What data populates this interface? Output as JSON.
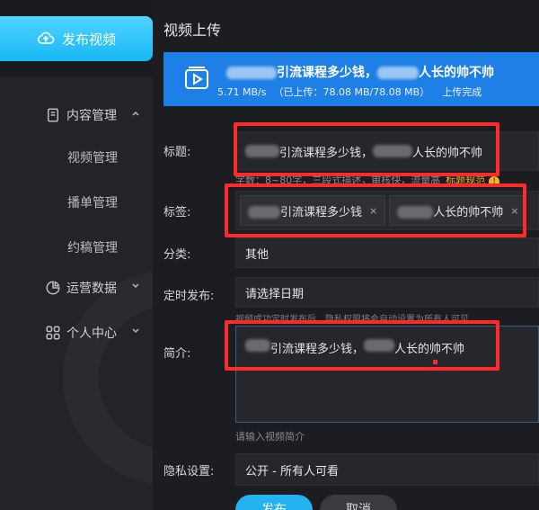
{
  "sidebar": {
    "publish_button": "发布视频",
    "items": [
      {
        "label": "内容管理",
        "icon": "file-icon",
        "expanded": true
      },
      {
        "label": "视频管理"
      },
      {
        "label": "播单管理"
      },
      {
        "label": "约稿管理"
      },
      {
        "label": "运营数据",
        "icon": "pie-chart-icon",
        "expanded": false
      },
      {
        "label": "个人中心",
        "icon": "grid-icon",
        "expanded": false
      }
    ]
  },
  "main": {
    "title": "视频上传",
    "upload": {
      "file_name_visible": "引流课程多少钱，",
      "file_name_tail": "人长的帅不帅",
      "speed": "5.71 MB/s",
      "progress": "（已上传：78.08 MB/78.08 MB）",
      "status": "上传完成",
      "progress_fraction": 1.0
    },
    "form": {
      "title_label": "标题:",
      "title_value_a": "引流课程多少钱，",
      "title_value_b": "人长的帅不帅",
      "hint": "字数：8~80字，三段式描述，审核快，流量高",
      "hint_link": "标题规范",
      "tags_label": "标签:",
      "tags": [
        {
          "text": "引流课程多少钱"
        },
        {
          "text": "人长的帅不帅"
        }
      ],
      "tag_remove": "×",
      "category_label": "分类:",
      "category_value": "其他",
      "schedule_label": "定时发布:",
      "schedule_value": "请选择日期",
      "schedule_note": "视频成功定时发布后，隐私权限将会自动设置为所有人可见",
      "intro_label": "简介:",
      "intro_value_a": "引流课程多少钱，",
      "intro_value_b": "人长的帅不帅",
      "intro_placeholder": "请输入视频简介",
      "privacy_label": "隐私设置:",
      "privacy_value": "公开 - 所有人可看",
      "publish": "发布",
      "cancel": "取消"
    }
  },
  "colors": {
    "accent": "#23b3f0",
    "upload_bg": "#1e7fe6",
    "annotation": "#ff2a2a",
    "warning": "#f0b429"
  }
}
